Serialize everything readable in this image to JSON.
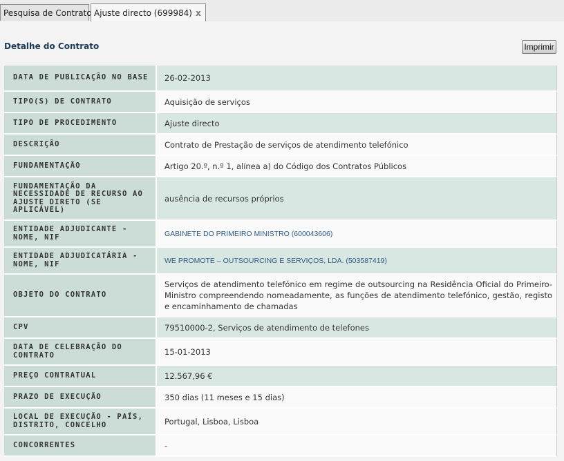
{
  "tabs": [
    {
      "label": "Pesquisa de Contratos"
    },
    {
      "label": "Ajuste directo (699984)",
      "close_glyph": "x"
    }
  ],
  "panel": {
    "title": "Detalhe do Contrato",
    "print_label": "Imprimir"
  },
  "rows": [
    {
      "label": "DATA DE PUBLICAÇÃO NO BASE",
      "value": "26-02-2013"
    },
    {
      "label": "TIPO(S) DE CONTRATO",
      "value": "Aquisição de serviços"
    },
    {
      "label": "TIPO DE PROCEDIMENTO",
      "value": "Ajuste directo"
    },
    {
      "label": "DESCRIÇÃO",
      "value": "Contrato de Prestação de serviços de atendimento telefónico"
    },
    {
      "label": "FUNDAMENTAÇÃO",
      "value": "Artigo 20.º, n.º 1, alínea a) do Código dos Contratos Públicos"
    },
    {
      "label": "FUNDAMENTAÇÃO DA NECESSIDADE DE RECURSO AO AJUSTE DIRETO (SE APLICÁVEL)",
      "value": "ausência de recursos próprios"
    },
    {
      "label": "ENTIDADE ADJUDICANTE - NOME, NIF",
      "value": "GABINETE DO PRIMEIRO MINISTRO (600043606)"
    },
    {
      "label": "ENTIDADE ADJUDICATÁRIA - NOME, NIF",
      "value": "WE PROMOTE – OUTSOURCING E SERVIÇOS, LDA. (503587419)"
    },
    {
      "label": "OBJETO DO CONTRATO",
      "value": "Serviços de atendimento telefónico em regime de outsourcing na Residência Oficial do Primeiro-Ministro compreendendo nomeadamente, as funções de atendimento telefónico, gestão, registo e encaminhamento de chamadas"
    },
    {
      "label": "CPV",
      "value": "79510000-2, Serviços de atendimento de telefones"
    },
    {
      "label": "DATA DE CELEBRAÇÃO DO CONTRATO",
      "value": "15-01-2013"
    },
    {
      "label": "PREÇO CONTRATUAL",
      "value": "12.567,96 €"
    },
    {
      "label": "PRAZO DE EXECUÇÃO",
      "value": "350 dias (11 meses e 15 dias)"
    },
    {
      "label": "LOCAL DE EXECUÇÃO - PAÍS, DISTRITO, CONCELHO",
      "value": "Portugal, Lisboa, Lisboa"
    },
    {
      "label": "CONCORRENTES",
      "value": "-"
    }
  ]
}
